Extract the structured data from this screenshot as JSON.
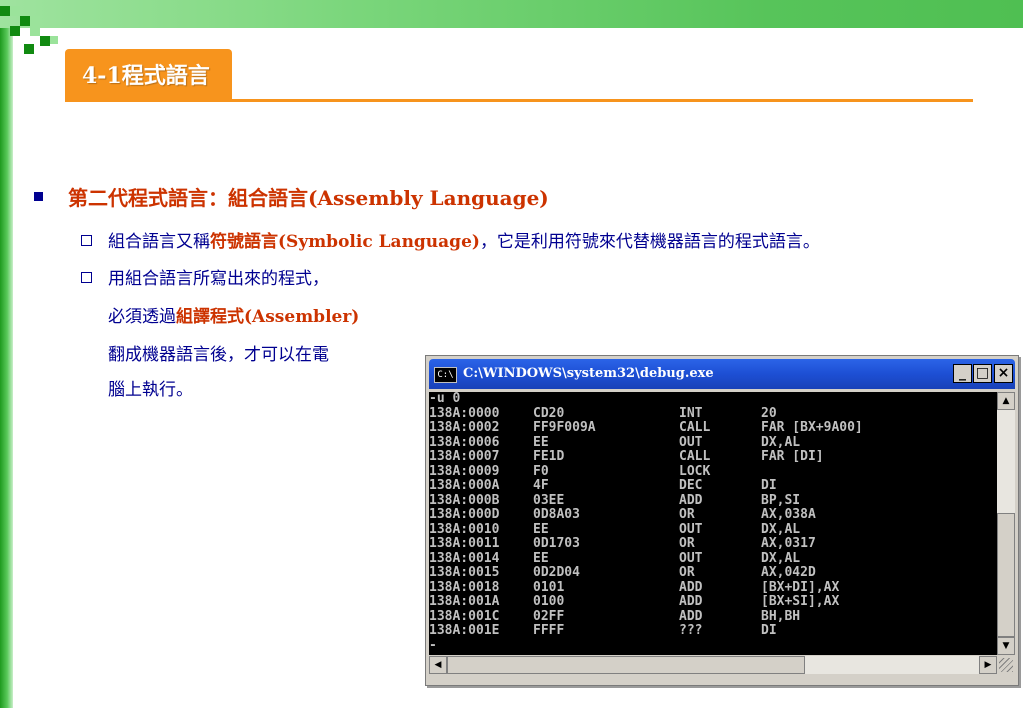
{
  "slide": {
    "title": "4-1程式語言",
    "heading": {
      "zh": "第二代程式語言：組合語言",
      "en": "(Assembly Language)"
    },
    "bullets": [
      {
        "part1": "組合語言又稱",
        "emph": "符號語言",
        "en": "(Symbolic Language)",
        "part2": "，它是利用符號來代替機器語言的程式語言。"
      },
      {
        "line1": "用組合語言所寫出來的程式，",
        "line2_pre": "必須透過",
        "line2_emph": "組譯程式",
        "line2_en": "(Assembler)",
        "line3": "翻成機器語言後，才可以在電",
        "line4": "腦上執行。"
      }
    ]
  },
  "console": {
    "title": "C:\\WINDOWS\\system32\\debug.exe",
    "icon_label": "C:\\",
    "buttons": {
      "minimize": "_",
      "maximize": "□",
      "close": "×"
    },
    "first_line": "-u 0",
    "last_line": "-",
    "rows": [
      {
        "addr": "138A:0000",
        "hex": "CD20",
        "op": "INT",
        "arg": "20"
      },
      {
        "addr": "138A:0002",
        "hex": "FF9F009A",
        "op": "CALL",
        "arg": "FAR [BX+9A00]"
      },
      {
        "addr": "138A:0006",
        "hex": "EE",
        "op": "OUT",
        "arg": "DX,AL"
      },
      {
        "addr": "138A:0007",
        "hex": "FE1D",
        "op": "CALL",
        "arg": "FAR [DI]"
      },
      {
        "addr": "138A:0009",
        "hex": "F0",
        "op": "LOCK",
        "arg": ""
      },
      {
        "addr": "138A:000A",
        "hex": "4F",
        "op": "DEC",
        "arg": "DI"
      },
      {
        "addr": "138A:000B",
        "hex": "03EE",
        "op": "ADD",
        "arg": "BP,SI"
      },
      {
        "addr": "138A:000D",
        "hex": "0D8A03",
        "op": "OR",
        "arg": "AX,038A"
      },
      {
        "addr": "138A:0010",
        "hex": "EE",
        "op": "OUT",
        "arg": "DX,AL"
      },
      {
        "addr": "138A:0011",
        "hex": "0D1703",
        "op": "OR",
        "arg": "AX,0317"
      },
      {
        "addr": "138A:0014",
        "hex": "EE",
        "op": "OUT",
        "arg": "DX,AL"
      },
      {
        "addr": "138A:0015",
        "hex": "0D2D04",
        "op": "OR",
        "arg": "AX,042D"
      },
      {
        "addr": "138A:0018",
        "hex": "0101",
        "op": "ADD",
        "arg": "[BX+DI],AX"
      },
      {
        "addr": "138A:001A",
        "hex": "0100",
        "op": "ADD",
        "arg": "[BX+SI],AX"
      },
      {
        "addr": "138A:001C",
        "hex": "02FF",
        "op": "ADD",
        "arg": "BH,BH"
      },
      {
        "addr": "138A:001E",
        "hex": "FFFF",
        "op": "???",
        "arg": "DI"
      }
    ]
  },
  "colors": {
    "accent_orange": "#f7941d",
    "heading_red": "#cc3300",
    "text_navy": "#000090",
    "titlebar_blue": "#1d4fd4"
  }
}
